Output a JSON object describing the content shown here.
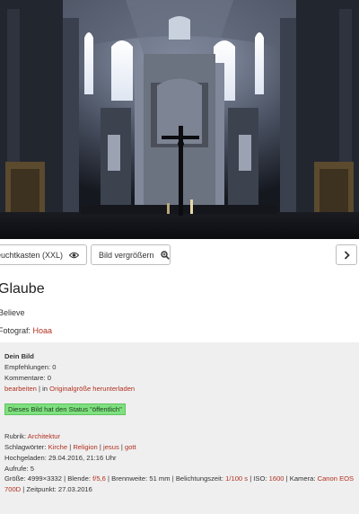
{
  "buttons": {
    "lightbox_label": "Leuchtkasten (XXL)",
    "enlarge_label": "Bild vergrößern"
  },
  "image": {
    "title": "Glaube",
    "subtitle": "Believe",
    "photographer_label": "Fotograf:",
    "photographer_name": "Hoaa"
  },
  "details": {
    "heading": "Dein Bild",
    "recommendations_label": "Empfehlungen:",
    "recommendations_value": "0",
    "comments_label": "Kommentare:",
    "comments_value": "0",
    "edit_link": "bearbeiten",
    "separator": "|",
    "download_prefix": "in",
    "download_link": "Originalgröße herunterladen",
    "status_text": "Dieses Bild hat den Status \"öffentlich\"",
    "category_label": "Rubrik:",
    "category_value": "Architektur",
    "tags_label": "Schlagwörter:",
    "tags": [
      "Kirche",
      "Religion",
      "jesus",
      "gott"
    ],
    "uploaded_label": "Hochgeladen:",
    "uploaded_value": "29.04.2016, 21:16 Uhr",
    "views_label": "Aufrufe:",
    "views_value": "5",
    "size_label": "Größe:",
    "size_value": "4999×3332",
    "aperture_label": "Blende:",
    "aperture_value": "f/5,6",
    "focal_label": "Brennweite:",
    "focal_value": "51 mm",
    "exposure_label": "Belichtungszeit:",
    "exposure_value": "1/100 s",
    "iso_label": "ISO:",
    "iso_value": "1600",
    "camera_label": "Kamera:",
    "camera_value": "Canon EOS 700D",
    "timestamp_label": "Zeitpunkt:",
    "timestamp_value": "27.03.2016"
  },
  "icons": {
    "lightbox": "eye-icon",
    "enlarge": "magnifier-plus-icon",
    "next": "chevron-right-icon"
  }
}
